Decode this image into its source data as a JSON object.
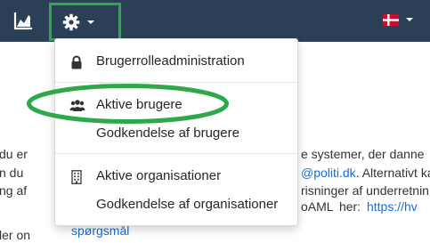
{
  "navbar": {
    "bg_color": "#2b3f56",
    "chart_icon": "area-chart-icon",
    "settings_icon": "gear-icon",
    "language_icon": "danish-flag-icon",
    "highlight_color": "#2ea84a"
  },
  "dropdown": {
    "items": [
      {
        "label": "Brugerrolleadministration",
        "icon": "lock-icon"
      },
      {
        "label": "Aktive brugere",
        "icon": "users-icon"
      },
      {
        "label": "Godkendelse af brugere",
        "icon": ""
      },
      {
        "label": "Aktive organisationer",
        "icon": "building-icon"
      },
      {
        "label": "Godkendelse af organisationer",
        "icon": ""
      }
    ]
  },
  "background": {
    "left_lines": [
      "du er",
      "n du",
      "ng af",
      "ler on"
    ],
    "right_line1": "e systemer, der danne",
    "right_line2_link": "@politi.dk",
    "right_line2_rest": ". Alternativt ka",
    "right_line3": "risninger af underretnin",
    "right_line4_text": "oAML  her:  ",
    "right_line4_link": "https://hv",
    "bottom_cut": "spørgsmål"
  }
}
